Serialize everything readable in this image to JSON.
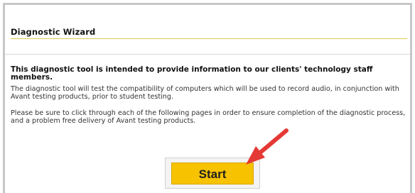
{
  "wizard": {
    "title": "Diagnostic Wizard",
    "intro": "This diagnostic tool is intended to provide information to our clients' technology staff members.",
    "paragraph_1": "The diagnostic tool will test the compatibility of computers which will be used to record audio, in conjunction with Avant testing products, prior to student testing.",
    "paragraph_2": "Please be sure to click through each of the following pages in order to ensure completion of the diagnostic process, and a problem free delivery of Avant testing products.",
    "start_label": "Start"
  },
  "annotation": {
    "icon": "red-arrow-icon",
    "color": "#e53935"
  },
  "colors": {
    "accent": "#f7c300",
    "rule": "#e3c84f"
  }
}
